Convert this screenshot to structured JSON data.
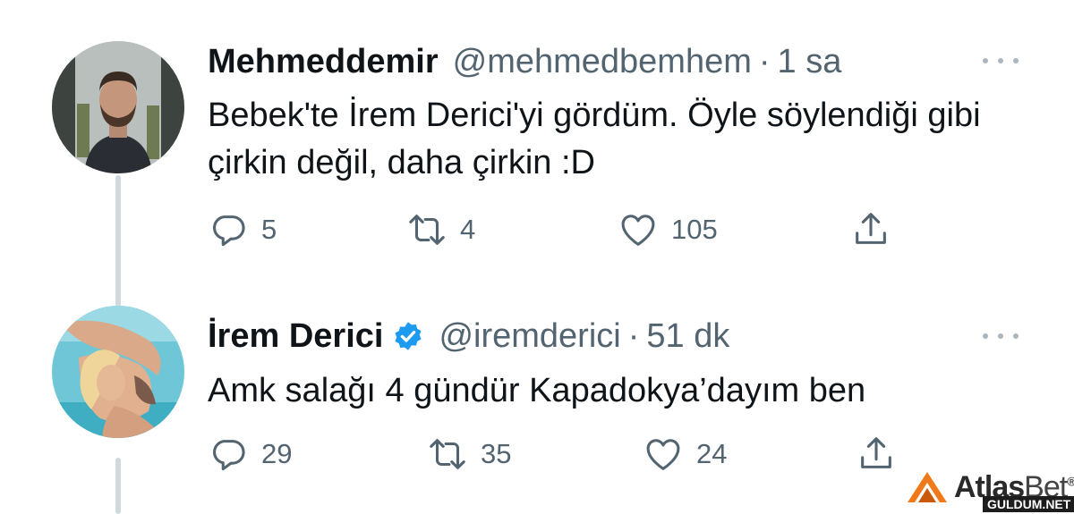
{
  "tweets": [
    {
      "display_name": "Mehmeddemir",
      "handle": "@mehmedbemhem",
      "separator": "·",
      "time": "1 sa",
      "verified": false,
      "text": "Bebek'te İrem Derici'yi gördüm. Öyle söylendiği gibi çirkin değil, daha çirkin :D",
      "replies": "5",
      "retweets": "4",
      "likes": "105"
    },
    {
      "display_name": "İrem Derici",
      "handle": "@iremderici",
      "separator": "·",
      "time": "51 dk",
      "verified": true,
      "text": "Amk salağı 4 gündür Kapadokya’dayım ben",
      "replies": "29",
      "retweets": "35",
      "likes": "24"
    }
  ],
  "icons": {
    "reply": "reply-icon",
    "retweet": "retweet-icon",
    "like": "heart-icon",
    "share": "share-icon",
    "more": "more-dots-icon",
    "verified": "verified-badge-icon"
  },
  "colors": {
    "text_primary": "#0f1419",
    "text_secondary": "#536471",
    "thread_line": "#cfd9de",
    "verified_blue": "#1d9bf0",
    "watermark_orange": "#f07a1a"
  },
  "watermark": {
    "brand_bold": "Atlas",
    "brand_light": "Bet",
    "registered": "®",
    "site": "GULDUM.NET"
  }
}
